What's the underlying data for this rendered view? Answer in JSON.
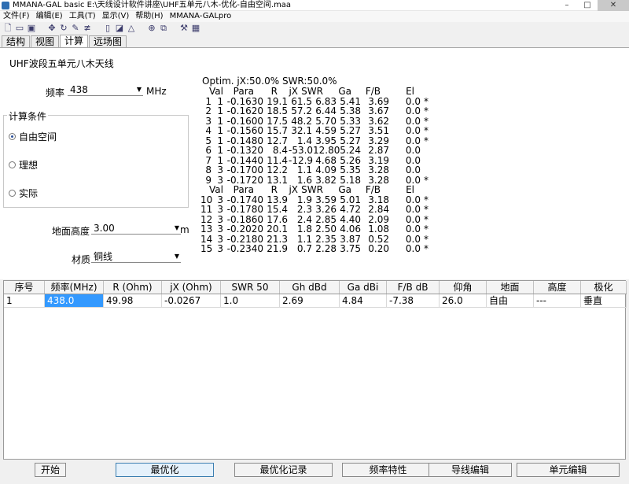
{
  "window": {
    "title": "MMANA-GAL basic  E:\\天线设计软件讲座\\UHF五单元八木-优化-自由空间.maa",
    "controls": [
      "–",
      "□",
      "✕"
    ]
  },
  "menu": [
    "文件(F)",
    "编辑(E)",
    "工具(T)",
    "显示(V)",
    "帮助(H)",
    "MMANA-GALpro"
  ],
  "toolbar": [
    "new-icon",
    "open-icon",
    "save-icon",
    "move-icon",
    "rotate-icon",
    "edit-icon",
    "wire-icon",
    "page-icon",
    "view-icon",
    "triangle-icon",
    "target-icon",
    "copy-icon",
    "tools-icon",
    "calculator-icon"
  ],
  "tabs": [
    "结构",
    "视图",
    "计算",
    "远场图"
  ],
  "active_tab": 2,
  "panel": {
    "heading": "UHF波段五单元八木天线",
    "freq_label": "频率",
    "freq_value": "438",
    "freq_unit": "MHz",
    "conditions_title": "计算条件",
    "radios": [
      {
        "label": "自由空间",
        "selected": true
      },
      {
        "label": "理想",
        "selected": false
      },
      {
        "label": "实际",
        "selected": false
      }
    ],
    "height_label": "地面高度",
    "height_value": "3.00",
    "height_unit": "m",
    "material_label": "材质",
    "material_value": "铜线"
  },
  "results": {
    "optim": "Optim. jX:50.0% SWR:50.0%",
    "header": [
      "Val",
      "Para",
      "R",
      "jX",
      "SWR",
      "Ga",
      "F/B",
      "El"
    ],
    "rows_a": [
      [
        "1",
        "1",
        "-0.1630",
        "19.1",
        "61.5",
        "6.83",
        "5.41",
        "3.69",
        "0.0",
        "*"
      ],
      [
        "2",
        "1",
        "-0.1620",
        "18.5",
        "57.2",
        "6.44",
        "5.38",
        "3.67",
        "0.0",
        "*"
      ],
      [
        "3",
        "1",
        "-0.1600",
        "17.5",
        "48.2",
        "5.70",
        "5.33",
        "3.62",
        "0.0",
        "*"
      ],
      [
        "4",
        "1",
        "-0.1560",
        "15.7",
        "32.1",
        "4.59",
        "5.27",
        "3.51",
        "0.0",
        "*"
      ],
      [
        "5",
        "1",
        "-0.1480",
        "12.7",
        "1.4",
        "3.95",
        "5.27",
        "3.29",
        "0.0",
        "*"
      ],
      [
        "6",
        "1",
        "-0.1320",
        "8.4",
        "-53.0",
        "12.80",
        "5.24",
        "2.87",
        "0.0",
        ""
      ],
      [
        "7",
        "1",
        "-0.1440",
        "11.4",
        "-12.9",
        "4.68",
        "5.26",
        "3.19",
        "0.0",
        ""
      ],
      [
        "8",
        "3",
        "-0.1700",
        "12.2",
        "1.1",
        "4.09",
        "5.35",
        "3.28",
        "0.0",
        ""
      ],
      [
        "9",
        "3",
        "-0.1720",
        "13.1",
        "1.6",
        "3.82",
        "5.18",
        "3.28",
        "0.0",
        "*"
      ]
    ],
    "rows_b": [
      [
        "10",
        "3",
        "-0.1740",
        "13.9",
        "1.9",
        "3.59",
        "5.01",
        "3.18",
        "0.0",
        "*"
      ],
      [
        "11",
        "3",
        "-0.1780",
        "15.4",
        "2.3",
        "3.26",
        "4.72",
        "2.84",
        "0.0",
        "*"
      ],
      [
        "12",
        "3",
        "-0.1860",
        "17.6",
        "2.4",
        "2.85",
        "4.40",
        "2.09",
        "0.0",
        "*"
      ],
      [
        "13",
        "3",
        "-0.2020",
        "20.1",
        "1.8",
        "2.50",
        "4.06",
        "1.08",
        "0.0",
        "*"
      ],
      [
        "14",
        "3",
        "-0.2180",
        "21.3",
        "1.1",
        "2.35",
        "3.87",
        "0.52",
        "0.0",
        "*"
      ],
      [
        "15",
        "3",
        "-0.2340",
        "21.9",
        "0.7",
        "2.28",
        "3.75",
        "0.20",
        "0.0",
        "*"
      ]
    ]
  },
  "grid": {
    "columns": [
      "序号",
      "频率(MHz)",
      "R (Ohm)",
      "jX (Ohm)",
      "SWR 50",
      "Gh dBd",
      "Ga dBi",
      "F/B dB",
      "仰角",
      "地面",
      "高度",
      "极化"
    ],
    "row": [
      "1",
      "438.0",
      "49.98",
      "-0.0267",
      "1.0",
      "2.69",
      "4.84",
      "-7.38",
      "26.0",
      "自由",
      "---",
      "垂直"
    ]
  },
  "buttons": {
    "start": "开始",
    "optimize": "最优化",
    "optimize_log": "最优化记录",
    "freq_char": "频率特性",
    "wire_edit": "导线编辑",
    "element_edit": "单元编辑"
  }
}
